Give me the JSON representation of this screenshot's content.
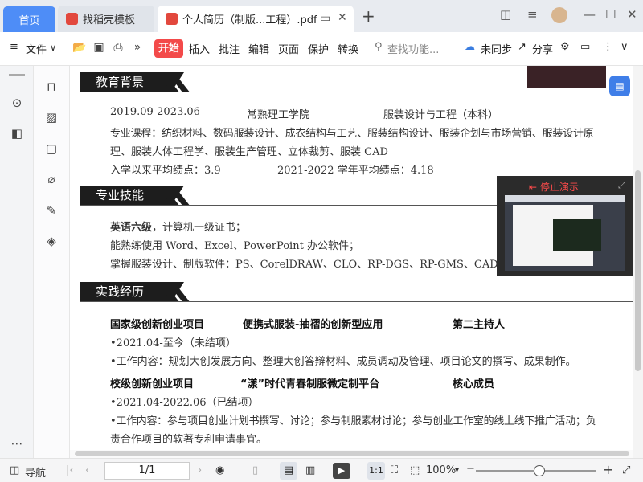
{
  "tabs": {
    "home": "首页",
    "template": "找稻壳模板",
    "document": "个人简历（制版...工程）.pdf",
    "new_tab": "+"
  },
  "toolbar": {
    "file": "文件",
    "start": "开始",
    "insert": "插入",
    "annotate": "批注",
    "edit": "编辑",
    "page": "页面",
    "protect": "保护",
    "convert": "转换",
    "search_placeholder": "查找功能...",
    "unsynced": "未同步",
    "share": "分享"
  },
  "document": {
    "sections": {
      "education": {
        "title": "教育背景",
        "period": "2019.09-2023.06",
        "school": "常熟理工学院",
        "major": "服装设计与工程（本科）",
        "courses_line1": "专业课程：纺织材料、数码服装设计、成衣结构与工艺、服装结构设计、服装企划与市场营销、服装设计原",
        "courses_line2": "理、服装人体工程学、服装生产管理、立体裁剪、服装 CAD",
        "gpa_overall": "入学以来平均绩点：3.9",
        "gpa_year": "2021-2022 学年平均绩点：4.18"
      },
      "skills": {
        "title": "专业技能",
        "cet6": "英语六级",
        "cet_rest": "，计算机一级证书；",
        "office": "能熟练使用 Word、Excel、PowerPoint 办公软件；",
        "software": "掌握服装设计、制版软件：PS、CorelDRAW、CLO、RP-DGS、RP-GMS、CAD"
      },
      "practice": {
        "title": "实践经历",
        "p1_level": "国家级",
        "p1_name": "创新创业项目",
        "p1_topic": "便携式服装-抽褶的创新型应用",
        "p1_role": "第二主持人",
        "p1_date": "•2021.04-至今（未结项）",
        "p1_work": "•工作内容：规划大创发展方向、整理大创答辩材料、成员调动及管理、项目论文的撰写、成果制作。",
        "p2_name": "校级创新创业项目",
        "p2_topic": "“漾”时代青春制服微定制平台",
        "p2_role": "核心成员",
        "p2_date": "•2021.04-2022.06（已结项）",
        "p2_work1": "•工作内容：参与项目创业计划书撰写、讨论；参与制服素材讨论；参与创业工作室的线上线下推广活动；负",
        "p2_work2": "责合作项目的软著专利申请事宜。"
      }
    }
  },
  "overlay": {
    "stop_presenting": "停止演示"
  },
  "status": {
    "nav": "导航",
    "page_indicator": "1/1",
    "zoom": "100%"
  },
  "colors": {
    "accent": "#4e8df7",
    "start_button": "#f34a4a",
    "stop_red": "#ff4b4b"
  }
}
